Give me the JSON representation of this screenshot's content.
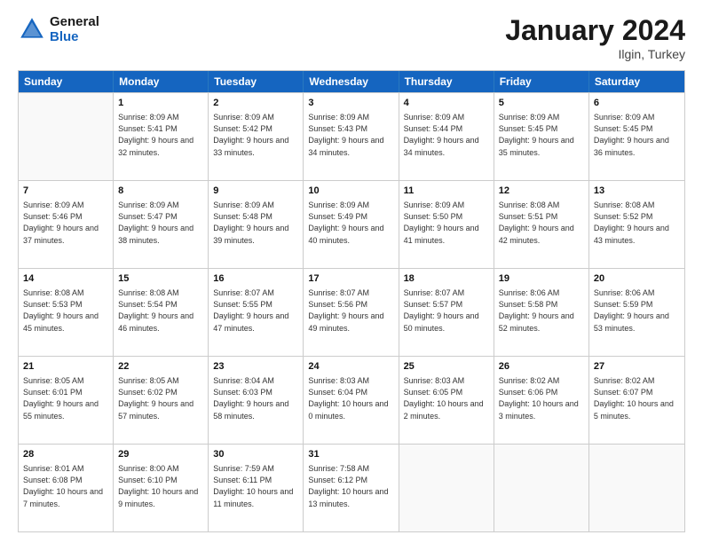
{
  "header": {
    "logo_general": "General",
    "logo_blue": "Blue",
    "month_title": "January 2024",
    "location": "Ilgin, Turkey"
  },
  "weekdays": [
    "Sunday",
    "Monday",
    "Tuesday",
    "Wednesday",
    "Thursday",
    "Friday",
    "Saturday"
  ],
  "rows": [
    [
      {
        "day": "",
        "sunrise": "",
        "sunset": "",
        "daylight": ""
      },
      {
        "day": "1",
        "sunrise": "Sunrise: 8:09 AM",
        "sunset": "Sunset: 5:41 PM",
        "daylight": "Daylight: 9 hours and 32 minutes."
      },
      {
        "day": "2",
        "sunrise": "Sunrise: 8:09 AM",
        "sunset": "Sunset: 5:42 PM",
        "daylight": "Daylight: 9 hours and 33 minutes."
      },
      {
        "day": "3",
        "sunrise": "Sunrise: 8:09 AM",
        "sunset": "Sunset: 5:43 PM",
        "daylight": "Daylight: 9 hours and 34 minutes."
      },
      {
        "day": "4",
        "sunrise": "Sunrise: 8:09 AM",
        "sunset": "Sunset: 5:44 PM",
        "daylight": "Daylight: 9 hours and 34 minutes."
      },
      {
        "day": "5",
        "sunrise": "Sunrise: 8:09 AM",
        "sunset": "Sunset: 5:45 PM",
        "daylight": "Daylight: 9 hours and 35 minutes."
      },
      {
        "day": "6",
        "sunrise": "Sunrise: 8:09 AM",
        "sunset": "Sunset: 5:45 PM",
        "daylight": "Daylight: 9 hours and 36 minutes."
      }
    ],
    [
      {
        "day": "7",
        "sunrise": "Sunrise: 8:09 AM",
        "sunset": "Sunset: 5:46 PM",
        "daylight": "Daylight: 9 hours and 37 minutes."
      },
      {
        "day": "8",
        "sunrise": "Sunrise: 8:09 AM",
        "sunset": "Sunset: 5:47 PM",
        "daylight": "Daylight: 9 hours and 38 minutes."
      },
      {
        "day": "9",
        "sunrise": "Sunrise: 8:09 AM",
        "sunset": "Sunset: 5:48 PM",
        "daylight": "Daylight: 9 hours and 39 minutes."
      },
      {
        "day": "10",
        "sunrise": "Sunrise: 8:09 AM",
        "sunset": "Sunset: 5:49 PM",
        "daylight": "Daylight: 9 hours and 40 minutes."
      },
      {
        "day": "11",
        "sunrise": "Sunrise: 8:09 AM",
        "sunset": "Sunset: 5:50 PM",
        "daylight": "Daylight: 9 hours and 41 minutes."
      },
      {
        "day": "12",
        "sunrise": "Sunrise: 8:08 AM",
        "sunset": "Sunset: 5:51 PM",
        "daylight": "Daylight: 9 hours and 42 minutes."
      },
      {
        "day": "13",
        "sunrise": "Sunrise: 8:08 AM",
        "sunset": "Sunset: 5:52 PM",
        "daylight": "Daylight: 9 hours and 43 minutes."
      }
    ],
    [
      {
        "day": "14",
        "sunrise": "Sunrise: 8:08 AM",
        "sunset": "Sunset: 5:53 PM",
        "daylight": "Daylight: 9 hours and 45 minutes."
      },
      {
        "day": "15",
        "sunrise": "Sunrise: 8:08 AM",
        "sunset": "Sunset: 5:54 PM",
        "daylight": "Daylight: 9 hours and 46 minutes."
      },
      {
        "day": "16",
        "sunrise": "Sunrise: 8:07 AM",
        "sunset": "Sunset: 5:55 PM",
        "daylight": "Daylight: 9 hours and 47 minutes."
      },
      {
        "day": "17",
        "sunrise": "Sunrise: 8:07 AM",
        "sunset": "Sunset: 5:56 PM",
        "daylight": "Daylight: 9 hours and 49 minutes."
      },
      {
        "day": "18",
        "sunrise": "Sunrise: 8:07 AM",
        "sunset": "Sunset: 5:57 PM",
        "daylight": "Daylight: 9 hours and 50 minutes."
      },
      {
        "day": "19",
        "sunrise": "Sunrise: 8:06 AM",
        "sunset": "Sunset: 5:58 PM",
        "daylight": "Daylight: 9 hours and 52 minutes."
      },
      {
        "day": "20",
        "sunrise": "Sunrise: 8:06 AM",
        "sunset": "Sunset: 5:59 PM",
        "daylight": "Daylight: 9 hours and 53 minutes."
      }
    ],
    [
      {
        "day": "21",
        "sunrise": "Sunrise: 8:05 AM",
        "sunset": "Sunset: 6:01 PM",
        "daylight": "Daylight: 9 hours and 55 minutes."
      },
      {
        "day": "22",
        "sunrise": "Sunrise: 8:05 AM",
        "sunset": "Sunset: 6:02 PM",
        "daylight": "Daylight: 9 hours and 57 minutes."
      },
      {
        "day": "23",
        "sunrise": "Sunrise: 8:04 AM",
        "sunset": "Sunset: 6:03 PM",
        "daylight": "Daylight: 9 hours and 58 minutes."
      },
      {
        "day": "24",
        "sunrise": "Sunrise: 8:03 AM",
        "sunset": "Sunset: 6:04 PM",
        "daylight": "Daylight: 10 hours and 0 minutes."
      },
      {
        "day": "25",
        "sunrise": "Sunrise: 8:03 AM",
        "sunset": "Sunset: 6:05 PM",
        "daylight": "Daylight: 10 hours and 2 minutes."
      },
      {
        "day": "26",
        "sunrise": "Sunrise: 8:02 AM",
        "sunset": "Sunset: 6:06 PM",
        "daylight": "Daylight: 10 hours and 3 minutes."
      },
      {
        "day": "27",
        "sunrise": "Sunrise: 8:02 AM",
        "sunset": "Sunset: 6:07 PM",
        "daylight": "Daylight: 10 hours and 5 minutes."
      }
    ],
    [
      {
        "day": "28",
        "sunrise": "Sunrise: 8:01 AM",
        "sunset": "Sunset: 6:08 PM",
        "daylight": "Daylight: 10 hours and 7 minutes."
      },
      {
        "day": "29",
        "sunrise": "Sunrise: 8:00 AM",
        "sunset": "Sunset: 6:10 PM",
        "daylight": "Daylight: 10 hours and 9 minutes."
      },
      {
        "day": "30",
        "sunrise": "Sunrise: 7:59 AM",
        "sunset": "Sunset: 6:11 PM",
        "daylight": "Daylight: 10 hours and 11 minutes."
      },
      {
        "day": "31",
        "sunrise": "Sunrise: 7:58 AM",
        "sunset": "Sunset: 6:12 PM",
        "daylight": "Daylight: 10 hours and 13 minutes."
      },
      {
        "day": "",
        "sunrise": "",
        "sunset": "",
        "daylight": ""
      },
      {
        "day": "",
        "sunrise": "",
        "sunset": "",
        "daylight": ""
      },
      {
        "day": "",
        "sunrise": "",
        "sunset": "",
        "daylight": ""
      }
    ]
  ]
}
